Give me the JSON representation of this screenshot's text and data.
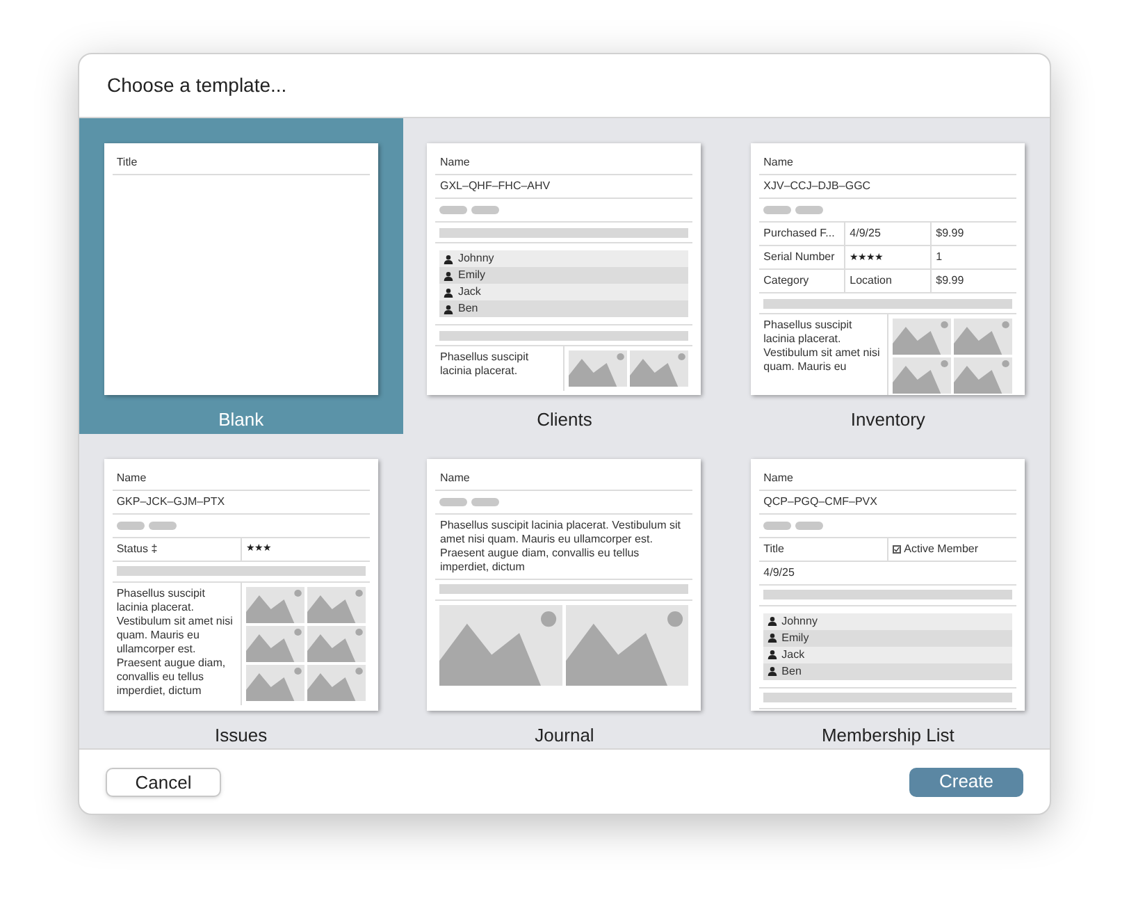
{
  "dialog": {
    "title": "Choose a template..."
  },
  "templates": [
    {
      "name": "Blank",
      "selected": true,
      "blocks": [
        {
          "kind": "label",
          "text": "Title"
        }
      ]
    },
    {
      "name": "Clients",
      "selected": false,
      "blocks": [
        {
          "kind": "label",
          "text": "Name"
        },
        {
          "kind": "label",
          "text": "GXL–QHF–FHC–AHV"
        },
        {
          "kind": "pills"
        },
        {
          "kind": "bar"
        },
        {
          "kind": "list",
          "items": [
            "Johnny",
            "Emily",
            "Jack",
            "Ben"
          ]
        },
        {
          "kind": "bar"
        },
        {
          "kind": "text-two-images",
          "text": "Phasellus suscipit lacinia placerat."
        }
      ]
    },
    {
      "name": "Inventory",
      "selected": false,
      "blocks": [
        {
          "kind": "label",
          "text": "Name"
        },
        {
          "kind": "label",
          "text": "XJV–CCJ–DJB–GGC"
        },
        {
          "kind": "pills"
        },
        {
          "kind": "grid",
          "cells": [
            {
              "kind": "text",
              "text": "Purchased F..."
            },
            {
              "kind": "text",
              "text": "4/9/25"
            },
            {
              "kind": "text",
              "text": "$9.99"
            }
          ]
        },
        {
          "kind": "grid",
          "cells": [
            {
              "kind": "text",
              "text": "Serial Number"
            },
            {
              "kind": "stars",
              "stars": 4
            },
            {
              "kind": "text",
              "text": "1"
            }
          ]
        },
        {
          "kind": "grid",
          "cells": [
            {
              "kind": "text",
              "text": "Category"
            },
            {
              "kind": "text",
              "text": "Location"
            },
            {
              "kind": "text",
              "text": "$9.99"
            }
          ]
        },
        {
          "kind": "bar"
        },
        {
          "kind": "text-four-images",
          "text": "Phasellus suscipit lacinia placerat. Vestibulum sit amet nisi quam. Mauris eu"
        }
      ]
    },
    {
      "name": "Issues",
      "selected": false,
      "blocks": [
        {
          "kind": "label",
          "text": "Name"
        },
        {
          "kind": "label",
          "text": "GKP–JCK–GJM–PTX"
        },
        {
          "kind": "pills"
        },
        {
          "kind": "grid",
          "cells": [
            {
              "kind": "text",
              "text": "Status ‡"
            },
            {
              "kind": "stars",
              "stars": 3
            }
          ]
        },
        {
          "kind": "bar"
        },
        {
          "kind": "text-six-images",
          "text": "Phasellus suscipit lacinia placerat. Vestibulum sit amet nisi quam. Mauris eu ullamcorper est. Praesent augue diam, convallis eu tellus imperdiet, dictum"
        }
      ]
    },
    {
      "name": "Journal",
      "selected": false,
      "blocks": [
        {
          "kind": "label",
          "text": "Name"
        },
        {
          "kind": "pills"
        },
        {
          "kind": "text",
          "text": "Phasellus suscipit lacinia placerat. Vestibulum sit amet nisi quam. Mauris eu ullamcorper est. Praesent augue diam, convallis eu tellus imperdiet, dictum"
        },
        {
          "kind": "bar"
        },
        {
          "kind": "large-images"
        }
      ]
    },
    {
      "name": "Membership List",
      "selected": false,
      "blocks": [
        {
          "kind": "label",
          "text": "Name"
        },
        {
          "kind": "label",
          "text": "QCP–PGQ–CMF–PVX"
        },
        {
          "kind": "pills"
        },
        {
          "kind": "grid",
          "cells": [
            {
              "kind": "text",
              "text": "Title"
            },
            {
              "kind": "check",
              "text": "Active Member",
              "checked": true
            }
          ]
        },
        {
          "kind": "label",
          "text": "4/9/25"
        },
        {
          "kind": "bar"
        },
        {
          "kind": "list",
          "items": [
            "Johnny",
            "Emily",
            "Jack",
            "Ben"
          ]
        },
        {
          "kind": "bar"
        }
      ]
    }
  ],
  "buttons": {
    "cancel": "Cancel",
    "create": "Create"
  }
}
